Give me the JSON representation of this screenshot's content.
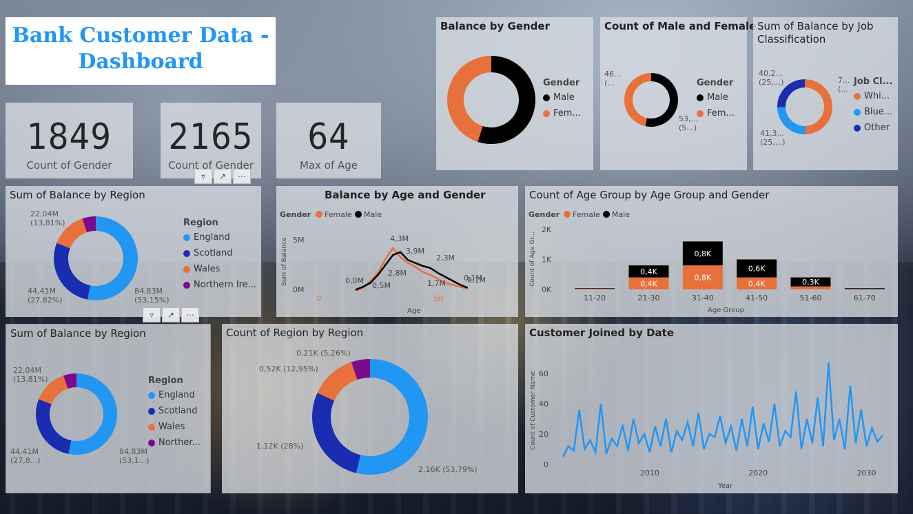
{
  "title": {
    "line1": "Bank Customer Data -",
    "line2": "Dashboard"
  },
  "cards": [
    {
      "value": "1849",
      "label": "Count of Gender"
    },
    {
      "value": "2165",
      "label": "Count of Gender"
    },
    {
      "value": "64",
      "label": "Max of Age"
    }
  ],
  "colors": {
    "orange": "#e8703a",
    "black": "#000000",
    "light_blue": "#2196f3",
    "dark_blue": "#1a2db0",
    "purple": "#7b0a8c"
  },
  "balance_by_gender": {
    "title": "Balance by Gender",
    "legend_title": "Gender",
    "legend": [
      "Male",
      "Fem..."
    ]
  },
  "count_male_female": {
    "title": "Count of Male and Female",
    "legend_title": "Gender",
    "legend": [
      "Male",
      "Fem..."
    ],
    "label_left": [
      "46...",
      "(..."
    ],
    "label_right": [
      "53,...",
      "(5...)"
    ]
  },
  "balance_by_job": {
    "title_line1": "Sum of Balance by Job",
    "title_line2": "Classification",
    "legend_title": "Job Cl...",
    "legend": [
      "Whi...",
      "Blue...",
      "Other"
    ],
    "label_top_left": [
      "40,2...",
      "(25,...)"
    ],
    "label_top_right": [
      "7...",
      "(..."
    ],
    "label_bottom_left": [
      "41,3...",
      "(25,...)"
    ]
  },
  "region_balance_1": {
    "title": "Sum of Balance by Region",
    "legend_title": "Region",
    "legend": [
      "England",
      "Scotland",
      "Wales",
      "Northern Ire..."
    ],
    "labels": {
      "wales": [
        "22,04M",
        "(13,81%)"
      ],
      "scotland": [
        "44,41M",
        "(27,82%)"
      ],
      "england": [
        "84,83M",
        "(53,15%)"
      ]
    }
  },
  "region_balance_2": {
    "title": "Sum of Balance by Region",
    "legend_title": "Region",
    "legend": [
      "England",
      "Scotland",
      "Wales",
      "Norther..."
    ],
    "labels": {
      "wales": [
        "22,04M",
        "(13,81%)"
      ],
      "scotland": [
        "44,41M",
        "(27,8...)"
      ],
      "england": [
        "84,83M",
        "(53,1...)"
      ]
    }
  },
  "count_region": {
    "title": "Count of Region by Region",
    "labels": {
      "purple": "0,21K (5,26%)",
      "orange": "0,52K (12,95%)",
      "scotland": "1,12K (28%)",
      "england": "2,16K (53,79%)"
    }
  },
  "chart_data": [
    {
      "type": "pie",
      "title": "Balance by Gender",
      "categories": [
        "Male",
        "Female"
      ],
      "values": [
        55,
        45
      ]
    },
    {
      "type": "pie",
      "title": "Count of Male and Female",
      "categories": [
        "Male",
        "Female"
      ],
      "values": [
        53,
        46
      ]
    },
    {
      "type": "pie",
      "title": "Sum of Balance by Job Classification",
      "categories": [
        "White Collar",
        "Blue Collar",
        "Other"
      ],
      "values": [
        49,
        25,
        25
      ]
    },
    {
      "type": "pie",
      "title": "Sum of Balance by Region",
      "categories": [
        "England",
        "Scotland",
        "Wales",
        "Northern Ireland"
      ],
      "values": [
        84.83,
        44.41,
        22.04,
        8.3
      ]
    },
    {
      "type": "pie",
      "title": "Count of Region by Region",
      "categories": [
        "England",
        "Scotland",
        "Wales",
        "Northern Ireland"
      ],
      "values": [
        2.16,
        1.12,
        0.52,
        0.21
      ]
    },
    {
      "type": "line",
      "title": "Balance by Age and Gender",
      "legend_title": "Gender",
      "series": [
        {
          "name": "Female",
          "x": [
            15,
            18,
            21,
            24,
            27,
            30,
            33,
            36,
            39,
            42,
            45,
            48,
            51,
            54,
            57,
            60
          ],
          "values": [
            0.0,
            0.3,
            1.0,
            1.8,
            3.2,
            4.3,
            3.4,
            2.8,
            2.4,
            1.9,
            1.6,
            1.2,
            0.8,
            0.6,
            0.4,
            0.2
          ]
        },
        {
          "name": "Male",
          "x": [
            15,
            18,
            21,
            24,
            27,
            30,
            33,
            36,
            39,
            42,
            45,
            48,
            51,
            54,
            57,
            60
          ],
          "values": [
            0.1,
            0.4,
            0.8,
            1.6,
            2.6,
            3.6,
            3.9,
            3.1,
            2.8,
            2.5,
            2.3,
            1.8,
            1.4,
            1.0,
            0.6,
            0.3
          ]
        }
      ],
      "xlabel": "Age",
      "ylabel": "Sum of Balance",
      "x_ticks": [
        "0",
        "50"
      ],
      "y_ticks": [
        "0M",
        "5M"
      ],
      "point_labels": [
        "4,3M",
        "3,9M",
        "2,8M",
        "2,3M",
        "0,0M",
        "0,5M",
        "0,1M",
        "1,7M",
        "0,1M"
      ],
      "ylim": [
        0,
        5
      ]
    },
    {
      "type": "bar",
      "title": "Count of Age Group by Age Group and Gender",
      "legend_title": "Gender",
      "categories": [
        "11-20",
        "21-30",
        "31-40",
        "41-50",
        "51-60",
        "61-70"
      ],
      "series": [
        {
          "name": "Female",
          "values": [
            0.02,
            0.4,
            0.8,
            0.4,
            0.1,
            0.01
          ],
          "labels": [
            "",
            "0,4K",
            "0,8K",
            "0,4K",
            "",
            ""
          ]
        },
        {
          "name": "Male",
          "values": [
            0.02,
            0.4,
            0.8,
            0.6,
            0.3,
            0.03
          ],
          "labels": [
            "",
            "0,4K",
            "0,8K",
            "0,6K",
            "0,3K",
            ""
          ]
        }
      ],
      "xlabel": "Age Group",
      "ylabel": "Count of Age Gr...",
      "y_ticks": [
        "0K",
        "1K",
        "2K"
      ],
      "ylim": [
        0,
        2
      ]
    },
    {
      "type": "line",
      "title": "Customer Joined by Date",
      "xlabel": "Year",
      "ylabel": "Count of Customer Name",
      "x_ticks": [
        "2010",
        "2020",
        "2030"
      ],
      "y_ticks": [
        "0",
        "20",
        "40",
        "60"
      ],
      "ylim": [
        0,
        70
      ],
      "xlim": [
        2002,
        2032
      ],
      "series": [
        {
          "name": "Count",
          "x": [
            2002.0,
            2002.5,
            2003.0,
            2003.5,
            2004.0,
            2004.5,
            2005.0,
            2005.5,
            2006.0,
            2006.5,
            2007.0,
            2007.5,
            2008.0,
            2008.5,
            2009.0,
            2009.5,
            2010.0,
            2010.5,
            2011.0,
            2011.5,
            2012.0,
            2012.5,
            2013.0,
            2013.5,
            2014.0,
            2014.5,
            2015.0,
            2015.5,
            2016.0,
            2016.5,
            2017.0,
            2017.5,
            2018.0,
            2018.5,
            2019.0,
            2019.5,
            2020.0,
            2020.5,
            2021.0,
            2021.5,
            2022.0,
            2022.5,
            2023.0,
            2023.5,
            2024.0,
            2024.5,
            2025.0,
            2025.5,
            2026.0,
            2026.5,
            2027.0,
            2027.5,
            2028.0,
            2028.5,
            2029.0,
            2029.5,
            2030.0,
            2030.5,
            2031.0,
            2031.5
          ],
          "values": [
            5,
            12,
            9,
            36,
            10,
            16,
            8,
            40,
            7,
            17,
            12,
            26,
            9,
            30,
            14,
            20,
            8,
            25,
            12,
            30,
            8,
            22,
            16,
            28,
            12,
            34,
            10,
            20,
            18,
            32,
            14,
            25,
            9,
            30,
            12,
            38,
            10,
            27,
            15,
            40,
            12,
            22,
            18,
            48,
            10,
            30,
            14,
            44,
            12,
            67,
            16,
            30,
            10,
            52,
            14,
            36,
            12,
            24,
            15,
            19
          ]
        }
      ]
    }
  ]
}
